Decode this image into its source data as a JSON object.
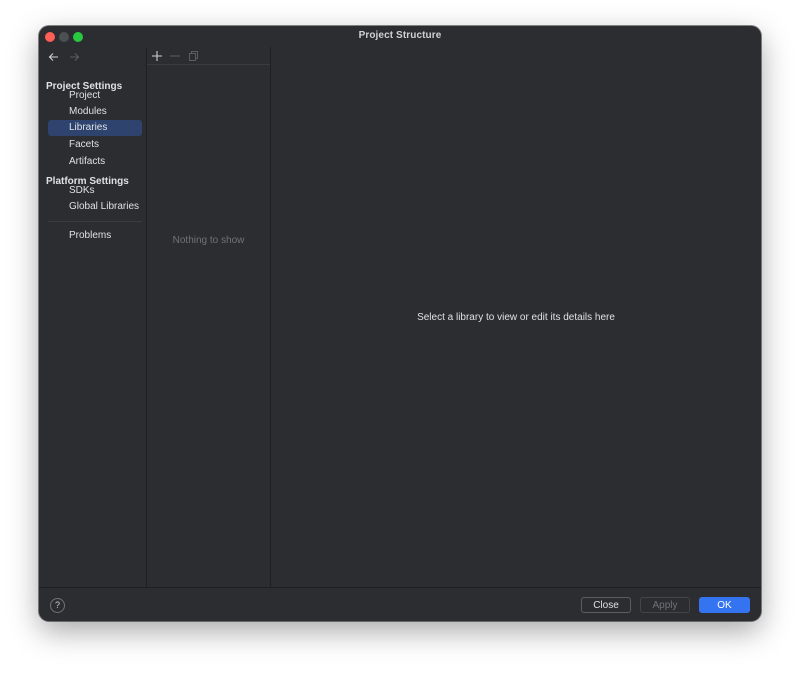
{
  "window": {
    "title": "Project Structure"
  },
  "nav": {
    "project_settings_title": "Project Settings",
    "project_items": [
      {
        "label": "Project",
        "selected": false
      },
      {
        "label": "Modules",
        "selected": false
      },
      {
        "label": "Libraries",
        "selected": true
      },
      {
        "label": "Facets",
        "selected": false
      },
      {
        "label": "Artifacts",
        "selected": false
      }
    ],
    "platform_settings_title": "Platform Settings",
    "platform_items": [
      {
        "label": "SDKs"
      },
      {
        "label": "Global Libraries"
      }
    ],
    "problems_label": "Problems",
    "icons": {
      "back": "arrow-left-icon",
      "forward": "arrow-right-icon"
    }
  },
  "list_pane": {
    "toolbar_icons": [
      "plus-icon",
      "minus-icon",
      "copy-icon"
    ],
    "empty_text": "Nothing to show"
  },
  "detail_pane": {
    "message": "Select a library to view or edit its details here"
  },
  "footer": {
    "help_label": "?",
    "close_label": "Close",
    "apply_label": "Apply",
    "ok_label": "OK"
  },
  "colors": {
    "background": "#2b2d30",
    "selection": "#2e436e",
    "accent": "#3574f0",
    "close_dot": "#ff5f57",
    "maximize_dot": "#28c840"
  }
}
